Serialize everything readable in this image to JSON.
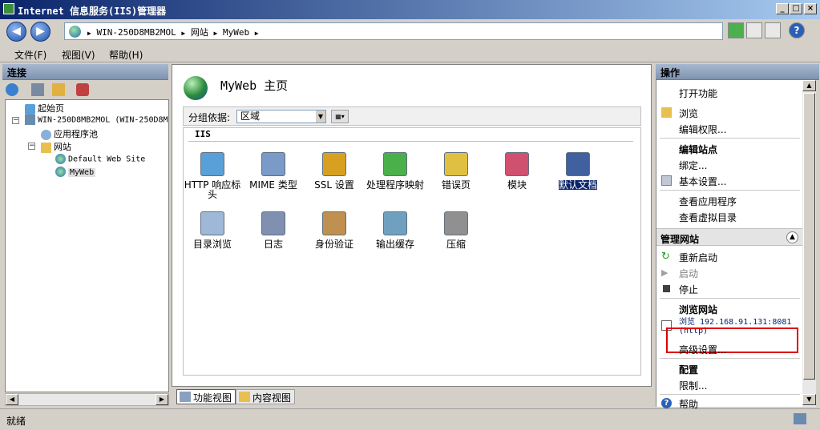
{
  "window": {
    "title": "Internet 信息服务(IIS)管理器"
  },
  "address": {
    "crumbs": [
      "WIN-250D8MB2MOL",
      "网站",
      "MyWeb"
    ]
  },
  "menu": [
    "文件(F)",
    "视图(V)",
    "帮助(H)"
  ],
  "connections": {
    "header": "连接",
    "tree": [
      {
        "label": "起始页"
      },
      {
        "label": "WIN-250D8MB2MOL (WIN-250D8M"
      },
      {
        "label": "应用程序池"
      },
      {
        "label": "网站"
      },
      {
        "label": "Default Web Site"
      },
      {
        "label": "MyWeb"
      }
    ]
  },
  "center": {
    "title": "MyWeb 主页",
    "group_label": "分组依据:",
    "group_value": "区域",
    "section": "IIS",
    "features": [
      {
        "label": "HTTP 响应标头",
        "icon": "http-response-icon"
      },
      {
        "label": "MIME 类型",
        "icon": "mime-icon"
      },
      {
        "label": "SSL 设置",
        "icon": "lock-icon"
      },
      {
        "label": "处理程序映射",
        "icon": "handler-icon"
      },
      {
        "label": "错误页",
        "icon": "error-page-icon"
      },
      {
        "label": "模块",
        "icon": "modules-icon"
      },
      {
        "label": "默认文档",
        "icon": "default-doc-icon"
      },
      {
        "label": "目录浏览",
        "icon": "dir-browse-icon"
      },
      {
        "label": "日志",
        "icon": "log-icon"
      },
      {
        "label": "身份验证",
        "icon": "auth-icon"
      },
      {
        "label": "输出缓存",
        "icon": "output-cache-icon"
      },
      {
        "label": "压缩",
        "icon": "compression-icon"
      }
    ],
    "view_tabs": [
      "功能视图",
      "内容视图"
    ]
  },
  "actions": {
    "header": "操作",
    "open_feature": "打开功能",
    "browse": "浏览",
    "edit_perm": "编辑权限...",
    "edit_site": "编辑站点",
    "bindings": "绑定...",
    "basic_settings": "基本设置...",
    "view_apps": "查看应用程序",
    "view_vdirs": "查看虚拟目录",
    "manage_site": "管理网站",
    "restart": "重新启动",
    "start": "启动",
    "stop": "停止",
    "browse_site": "浏览网站",
    "browse_url_1": "浏览 192.168.91.131:8081",
    "browse_url_2": "(http)",
    "advanced": "高级设置...",
    "config": "配置",
    "limits": "限制...",
    "help": "帮助"
  },
  "status": {
    "text": "就绪"
  },
  "colors": {
    "accent": "#0a246a",
    "highlight_box": "#e00000"
  }
}
